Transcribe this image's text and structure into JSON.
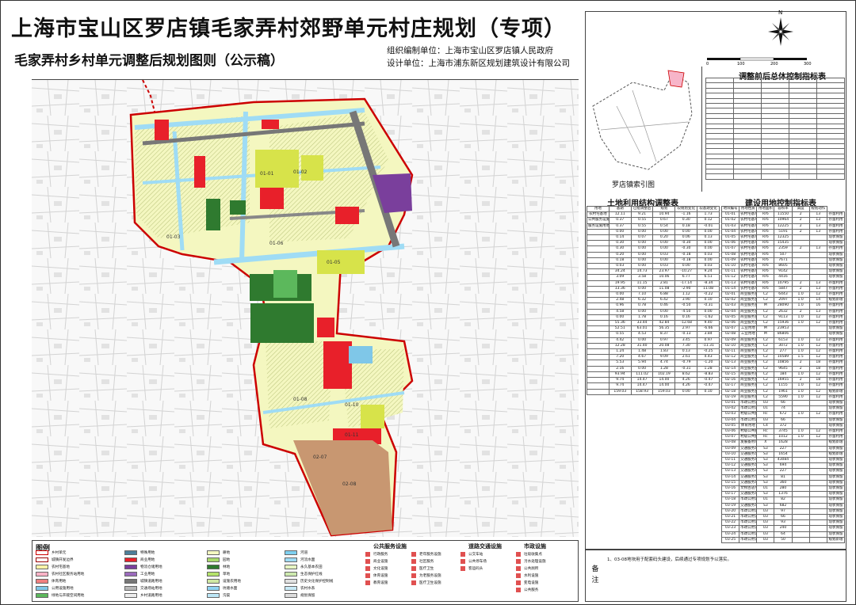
{
  "header": {
    "title": "上海市宝山区罗店镇毛家弄村郊野单元村庄规划（专项）",
    "subtitle": "毛家弄村乡村单元调整后规划图则（公示稿）",
    "org": "组织编制单位：上海市宝山区罗店镇人民政府",
    "designer": "设计单位：上海市浦东新区规划建筑设计有限公司"
  },
  "compass": {
    "north_label": "N"
  },
  "scale": {
    "labels": [
      "0",
      "100",
      "200",
      "300"
    ]
  },
  "right_panel": {
    "top_table_title": "调整前后总体控制指标表",
    "index_map_label": "罗店镇索引图",
    "landuse_table_title": "土地利用结构调整表",
    "construction_table_title": "建设用地控制指标表"
  },
  "map": {
    "parcel_labels": [
      "01-01",
      "01-02",
      "01-03",
      "01-05",
      "01-06",
      "01-08",
      "01-10",
      "01-11",
      "02-07",
      "02-08"
    ]
  },
  "landuse_table": {
    "header_row": [
      "用地",
      "基期",
      "已批调整后",
      "规划",
      "较规划变化",
      "较基期变化"
    ],
    "rows": [
      [
        "农村宅基地",
        "12.11",
        "9.21",
        "10.94",
        "-1.16",
        "1.73"
      ],
      [
        "公共服务设施用地",
        "0.37",
        "0.55",
        "0.67",
        "0.30",
        "0.12"
      ],
      [
        "服务设施用地",
        "0.37",
        "0.55",
        "0.54",
        "0.18",
        "-0.01"
      ],
      [
        "",
        "0.00",
        "0.00",
        "0.00",
        "0.00",
        "0.00"
      ],
      [
        "",
        "0.14",
        "0.07",
        "0.20",
        "0.06",
        "0.13"
      ],
      [
        "",
        "0.30",
        "0.00",
        "0.00",
        "-0.30",
        "0.00"
      ],
      [
        "",
        "0.30",
        "0.00",
        "0.00",
        "-0.30",
        "0.00"
      ],
      [
        "",
        "0.20",
        "0.00",
        "0.03",
        "-0.18",
        "0.03"
      ],
      [
        "",
        "0.18",
        "0.00",
        "0.00",
        "-0.18",
        "0.00"
      ],
      [
        "",
        "0.03",
        "0.00",
        "0.03",
        "0.00",
        "0.03"
      ],
      [
        "",
        "34.24",
        "14.73",
        "23.97",
        "-10.27",
        "9.24"
      ],
      [
        "",
        "3.09",
        "3.58",
        "10.06",
        "6.77",
        "6.51"
      ],
      [
        "",
        "19.95",
        "11.15",
        "2.81",
        "-17.14",
        "-8.34"
      ],
      [
        "",
        "13.36",
        "0.00",
        "11.08",
        "-2.90",
        "11.08"
      ],
      [
        "",
        "0.00",
        "7.10",
        "6.88",
        "1.12",
        "-0.22"
      ],
      [
        "",
        "2.48",
        "6.32",
        "6.42",
        "3.90",
        "0.10"
      ],
      [
        "",
        "0.96",
        "0.78",
        "0.46",
        "-0.50",
        "-0.31"
      ],
      [
        "",
        "4.58",
        "0.00",
        "0.00",
        "-4.50",
        "0.00"
      ],
      [
        "",
        "0.00",
        "1.78",
        "0.16",
        "0.16",
        "-1.62"
      ],
      [
        "",
        "55.36",
        "33.44",
        "42.84",
        "-12.68",
        "9.40"
      ],
      [
        "",
        "52.51",
        "63.01",
        "56.35",
        "2.97",
        "-6.66"
      ],
      [
        "",
        "0.55",
        "4.53",
        "8.37",
        "-0.13",
        "3.84"
      ],
      [
        "",
        "4.42",
        "0.00",
        "0.97",
        "3.45",
        "0.97"
      ],
      [
        "",
        "12.28",
        "31.40",
        "20.08",
        "7.30",
        "-11.31"
      ],
      [
        "",
        "1.24",
        "1.48",
        "1.83",
        "0.13",
        "-0.25"
      ],
      [
        "",
        "7.20",
        "4.67",
        "9.09",
        "2.61",
        "4.43"
      ],
      [
        "",
        "5.53",
        "5.94",
        "4.74",
        "-0.79",
        "-1.20"
      ],
      [
        "",
        "2.16",
        "0.00",
        "1.28",
        "-0.31",
        "1.28"
      ],
      [
        "",
        "93.94",
        "111.02",
        "102.19",
        "8.62",
        "-8.83"
      ],
      [
        "",
        "9.74",
        "14.47",
        "14.00",
        "4.26",
        "-0.47"
      ],
      [
        "",
        "9.74",
        "14.47",
        "14.00",
        "4.26",
        "-0.47"
      ],
      [
        "",
        "159.03",
        "158.93",
        "159.03",
        "0.00",
        "0.10"
      ]
    ]
  },
  "construction_table": {
    "header_row": [
      "地块编号",
      "用地性质",
      "用地面积",
      "容积率",
      "高度",
      "规划动作"
    ],
    "rows": [
      [
        "01-01",
        "农村宅基地",
        "Rr6",
        "11550",
        "2",
        "13",
        "存量利用"
      ],
      [
        "01-02",
        "农村宅基地",
        "Rr6",
        "10964",
        "2",
        "13",
        "存量利用"
      ],
      [
        "01-03",
        "农村宅基地",
        "Rr6",
        "12225",
        "2",
        "13",
        "存量利用"
      ],
      [
        "01-04",
        "农村宅基地",
        "Rr6",
        "5191",
        "2",
        "13",
        "存量利用"
      ],
      [
        "01-05",
        "农村宅基地",
        "Rr6",
        "12325",
        "",
        "",
        "现状保留"
      ],
      [
        "01-06",
        "农村宅基地",
        "Rr6",
        "15435",
        "",
        "",
        "现状保留"
      ],
      [
        "01-07",
        "农村宅基地",
        "Rr6",
        "2359",
        "2",
        "13",
        "存量利用"
      ],
      [
        "01-08",
        "农村宅基地",
        "Rr6",
        "507",
        "",
        "",
        "现状保留"
      ],
      [
        "01-09",
        "农村宅基地",
        "Rr6",
        "7671",
        "",
        "",
        "现状保留"
      ],
      [
        "01-10",
        "农村宅基地",
        "Rr6",
        "8605",
        "",
        "",
        "现状保留"
      ],
      [
        "01-11",
        "农村宅基地",
        "Rr6",
        "9142",
        "",
        "",
        "现状保留"
      ],
      [
        "01-12",
        "农村宅基地",
        "Rr6",
        "4416",
        "",
        "",
        "现状保留"
      ],
      [
        "01-13",
        "农村宅基地",
        "Rr6",
        "10795",
        "2",
        "13",
        "存量利用"
      ],
      [
        "01-14",
        "农村宅基地",
        "Rr6",
        "5847",
        "2",
        "13",
        "存量利用"
      ],
      [
        "02-01",
        "商业服务业用地",
        "C2",
        "6443",
        "1.0",
        "12",
        "存量利用"
      ],
      [
        "02-02",
        "商业服务业用地",
        "C2",
        "2097",
        "1.0",
        "14",
        "规划新增"
      ],
      [
        "02-03",
        "商业服务业用地",
        "M",
        "28090",
        "1.0",
        "16",
        "存量利用"
      ],
      [
        "02-04",
        "商业服务业用地",
        "C2",
        "2632",
        "2",
        "13",
        "存量利用"
      ],
      [
        "02-05",
        "商业服务业用地",
        "C2",
        "9113",
        "1.0",
        "12",
        "存量利用"
      ],
      [
        "02-06",
        "商业服务业用地",
        "C2",
        "15936",
        "1.0",
        "12",
        "存量利用"
      ],
      [
        "02-07",
        "工业用地",
        "M",
        "23953",
        "",
        "",
        "现状保留"
      ],
      [
        "02-08",
        "工业用地",
        "M",
        "86806",
        "",
        "",
        "现状保留"
      ],
      [
        "02-09",
        "商业服务业用地",
        "C2",
        "6153",
        "1.0",
        "12",
        "存量利用"
      ],
      [
        "02-10",
        "商业服务业用地",
        "C2",
        "3072",
        "1.0",
        "12",
        "存量利用"
      ],
      [
        "02-11",
        "商业服务业用地",
        "C2",
        "277",
        "1.0",
        "12",
        "存量利用"
      ],
      [
        "02-12",
        "商业服务业用地",
        "C2",
        "10589",
        "1.5",
        "12",
        "存量利用"
      ],
      [
        "02-13",
        "商业服务业用地",
        "C2",
        "10856",
        "2",
        "18",
        "存量利用"
      ],
      [
        "02-14",
        "商业服务业用地",
        "C2",
        "9645",
        "2",
        "18",
        "存量利用"
      ],
      [
        "02-15",
        "商业服务业用地",
        "C2",
        "184",
        "1.0",
        "12",
        "存量利用"
      ],
      [
        "02-16",
        "商业服务业用地",
        "C2",
        "16955",
        "2",
        "18",
        "存量利用"
      ],
      [
        "02-17",
        "商业服务业用地",
        "C2",
        "1155",
        "1.0",
        "12",
        "存量利用"
      ],
      [
        "02-18",
        "商业服务业用地",
        "C2",
        "1961",
        "1.0",
        "12",
        "规划新增"
      ],
      [
        "02-19",
        "商业服务业用地",
        "C2",
        "5590",
        "1.0",
        "12",
        "存量利用"
      ],
      [
        "03-01",
        "市政公用设施用地",
        "U3",
        "66",
        "",
        "",
        "现状保留"
      ],
      [
        "03-02",
        "市政公用设施用地",
        "U1",
        "74",
        "",
        "",
        "现状保留"
      ],
      [
        "03-03",
        "村级公共服务设施用地",
        "Rc",
        "672",
        "1.0",
        "12",
        "存量利用"
      ],
      [
        "03-04",
        "市政公用设施用地",
        "U3",
        "66",
        "",
        "",
        "现状保留"
      ],
      [
        "03-05",
        "体育用地",
        "C4",
        "372",
        "",
        "",
        "现状保留"
      ],
      [
        "03-06",
        "村级公共服务设施用地",
        "Rc",
        "3745",
        "1.0",
        "12",
        "存量利用"
      ],
      [
        "03-07",
        "村级公共服务设施用地",
        "Rc",
        "1012",
        "1.0",
        "12",
        "存量利用"
      ],
      [
        "03-08",
        "发展备用地",
        "X",
        "1628",
        "",
        "",
        "规划新增"
      ],
      [
        "03-09",
        "交通服务场站用地",
        "S3",
        "227",
        "",
        "",
        "现状保留"
      ],
      [
        "03-10",
        "交通服务场站用地",
        "S3",
        "1654",
        "",
        "",
        "规划新增"
      ],
      [
        "03-11",
        "交通服务场站用地",
        "S3",
        "43084",
        "",
        "",
        "现状保留"
      ],
      [
        "03-12",
        "交通服务场站用地",
        "S3",
        "694",
        "",
        "",
        "现状保留"
      ],
      [
        "03-13",
        "交通服务场站用地",
        "S3",
        "227",
        "",
        "",
        "现状保留"
      ],
      [
        "03-14",
        "交通服务场站用地",
        "S3",
        "81",
        "",
        "",
        "现状保留"
      ],
      [
        "03-15",
        "交通服务场站用地",
        "S3",
        "360",
        "",
        "",
        "现状保留"
      ],
      [
        "03-16",
        "文物古迹用地",
        "U1",
        "280",
        "",
        "",
        "现状保留"
      ],
      [
        "03-17",
        "交通服务场站用地",
        "S3",
        "1376",
        "",
        "",
        "现状保留"
      ],
      [
        "03-18",
        "市政公用设施用地",
        "U1",
        "82",
        "",
        "",
        "现状保留"
      ],
      [
        "03-19",
        "交通服务场站用地",
        "S3",
        "682",
        "",
        "",
        "现状保留"
      ],
      [
        "03-20",
        "市政公用设施用地",
        "U3",
        "97",
        "",
        "",
        "现状保留"
      ],
      [
        "03-21",
        "市政公用设施用地",
        "U3",
        "66",
        "",
        "",
        "现状保留"
      ],
      [
        "03-22",
        "市政公用设施用地",
        "U3",
        "93",
        "",
        "",
        "现状保留"
      ],
      [
        "03-23",
        "市政公用设施用地",
        "U3",
        "240",
        "",
        "",
        "现状保留"
      ],
      [
        "03-24",
        "市政公用设施用地",
        "U3",
        "64",
        "",
        "",
        "现状保留"
      ],
      [
        "03-25",
        "市政公用设施用地",
        "U3",
        "50",
        "",
        "",
        "规划新增"
      ]
    ]
  },
  "legend": {
    "title": "图例",
    "col1": [
      {
        "label": "乡村单元",
        "color": "#ffffff",
        "border": "#c00"
      },
      {
        "label": "城镇开发边界",
        "color": "#ffffff",
        "border": "#900"
      },
      {
        "label": "农村宅基地",
        "color": "#fff3a8"
      },
      {
        "label": "农村社区服务站用地",
        "color": "#ffb3c6"
      },
      {
        "label": "体育用地",
        "color": "#f07f7f"
      },
      {
        "label": "公用设施用地",
        "color": "#7fc7e8"
      },
      {
        "label": "绿地与开敞空间用地",
        "color": "#5cb85c"
      }
    ],
    "col2": [
      {
        "label": "特殊用地",
        "color": "#4d7f99"
      },
      {
        "label": "商业用地",
        "color": "#e8202a"
      },
      {
        "label": "物流仓储用地",
        "color": "#7a3f9c"
      },
      {
        "label": "工业用地",
        "color": "#9b6bbd"
      },
      {
        "label": "城镇道路用地",
        "color": "#777777"
      },
      {
        "label": "交通场站用地",
        "color": "#b7b7b7"
      },
      {
        "label": "乡村道路用地",
        "color": "#eeeeee"
      }
    ],
    "col3": [
      {
        "label": "耕地",
        "color": "#f4f7c0"
      },
      {
        "label": "园地",
        "color": "#a8d96b"
      },
      {
        "label": "林地",
        "color": "#2f7a2f"
      },
      {
        "label": "草地",
        "color": "#b4e26b"
      },
      {
        "label": "设施农用地",
        "color": "#cfe7a3"
      },
      {
        "label": "坑塘水面",
        "color": "#8fd3f2"
      },
      {
        "label": "沟渠",
        "color": "#bde7f7"
      }
    ],
    "col4": [
      {
        "label": "河道",
        "color": "#7fd0f0"
      },
      {
        "label": "河流水面",
        "color": "#9fdcf5"
      },
      {
        "label": "永久基本农田",
        "color": "#e6f5c2"
      },
      {
        "label": "生态保护红线",
        "color": "#cde9ae"
      },
      {
        "label": "历史文化保护控制线",
        "color": "#e0e0e0"
      },
      {
        "label": "农村水系",
        "color": "#c8eaf7"
      },
      {
        "label": "规划保留",
        "color": "#dddddd"
      }
    ],
    "public_head": "公共服务设施",
    "public": [
      "行政服务",
      "商业设施",
      "文化设施",
      "体育设施",
      "教育设施",
      "老年服务设施",
      "社区服务",
      "医疗卫生",
      "为老服务设施",
      "医疗卫生设施"
    ],
    "road_head": "道路交通设施",
    "road": [
      "公交车站",
      "公共停车场",
      "客运码头"
    ],
    "utility_head": "市政设施",
    "utility": [
      "垃圾收集点",
      "污水处理设施",
      "公共厕所",
      "水利设施",
      "变电设施",
      "公共服务"
    ]
  },
  "notes": {
    "label": "备注",
    "text": "1、03-08地块用于配套码头建设，后续通过专项规划予以落实。"
  }
}
